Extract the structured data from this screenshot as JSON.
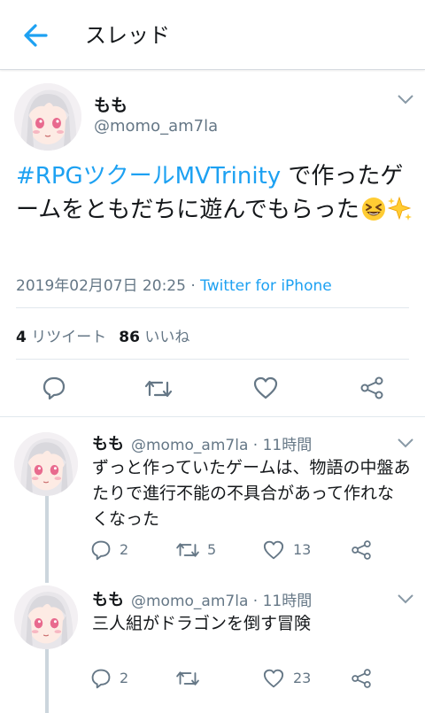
{
  "header": {
    "title": "スレッド"
  },
  "main_tweet": {
    "author_name": "もも",
    "handle": "@momo_am7la",
    "hashtag": "#RPGツクールMVTrinity",
    "text_after_hashtag": " で作ったゲームをともだちに遊んでもらった",
    "emojis": [
      "grinning-squint-emoji",
      "sparkles-emoji"
    ],
    "date": "2019年02月07日 20:25",
    "separator": " · ",
    "client": "Twitter for iPhone",
    "retweets": "4",
    "retweets_label": "リツイート",
    "likes": "86",
    "likes_label": "いいね"
  },
  "replies": [
    {
      "author_name": "もも",
      "handle_time": "@momo_am7la · 11時間",
      "text": "ずっと作っていたゲームは、物語の中盤あたりで進行不能の不具合があって作れなくなった",
      "reply_count": "2",
      "retweet_count": "5",
      "like_count": "13"
    },
    {
      "author_name": "もも",
      "handle_time": "@momo_am7la · 11時間",
      "text": "三人組がドラゴンを倒す冒険",
      "reply_count": "2",
      "retweet_count": "",
      "like_count": "23"
    }
  ],
  "colors": {
    "accent": "#1da1f2",
    "secondary_text": "#657786",
    "primary_text": "#14171a",
    "divider": "#e1e8ed",
    "thread_line": "#ccd6dd"
  }
}
